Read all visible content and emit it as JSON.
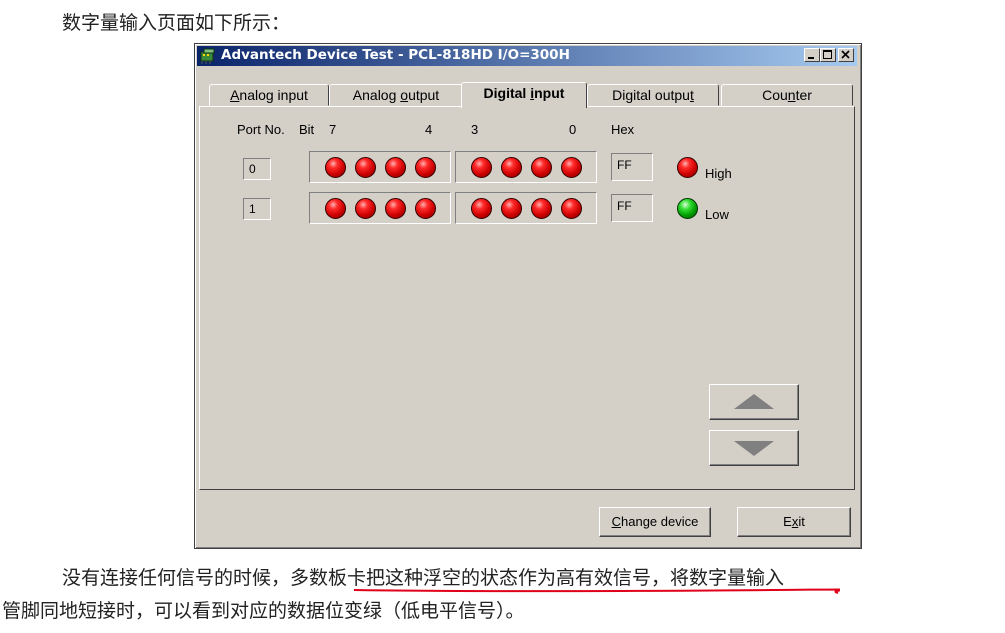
{
  "doc": {
    "intro": "数字量输入页面如下所示：",
    "line1_a": "没有连接任何信号的时候，",
    "line1_underlined": "多数板卡把这种浮空的状态作为高有效信号",
    "line1_b": "，将数字量输入",
    "line2": "管脚同地短接时，可以看到对应的数据位变绿（低电平信号）。"
  },
  "window": {
    "title": "Advantech Device Test - PCL-818HD I/O=300H",
    "tabs": [
      {
        "pre": "",
        "u": "A",
        "post": "nalog input"
      },
      {
        "pre": "Analog ",
        "u": "o",
        "post": "utput"
      },
      {
        "pre": "Digital ",
        "u": "i",
        "post": "nput"
      },
      {
        "pre": "Digital outpu",
        "u": "t",
        "post": ""
      },
      {
        "pre": "Cou",
        "u": "n",
        "post": "ter"
      }
    ],
    "active_tab": 2,
    "headers": {
      "port_no": "Port No.",
      "bit": "Bit",
      "b7": "7",
      "b4": "4",
      "b3": "3",
      "b0": "0",
      "hex": "Hex"
    },
    "rows": [
      {
        "port": "0",
        "bits": [
          "red",
          "red",
          "red",
          "red",
          "red",
          "red",
          "red",
          "red"
        ],
        "hex": "FF"
      },
      {
        "port": "1",
        "bits": [
          "red",
          "red",
          "red",
          "red",
          "red",
          "red",
          "red",
          "red"
        ],
        "hex": "FF"
      }
    ],
    "legend": [
      {
        "color": "red",
        "label": "High"
      },
      {
        "color": "green",
        "label": "Low"
      }
    ],
    "buttons": {
      "change": {
        "pre": "",
        "u": "C",
        "post": "hange device"
      },
      "exit": {
        "pre": "E",
        "u": "x",
        "post": "it"
      }
    },
    "colors": {
      "led_high": "#ff2a2a",
      "led_low": "#33dd33",
      "face": "#d4d0c8",
      "title_start": "#0a246a",
      "annotation": "#e0001a"
    }
  }
}
